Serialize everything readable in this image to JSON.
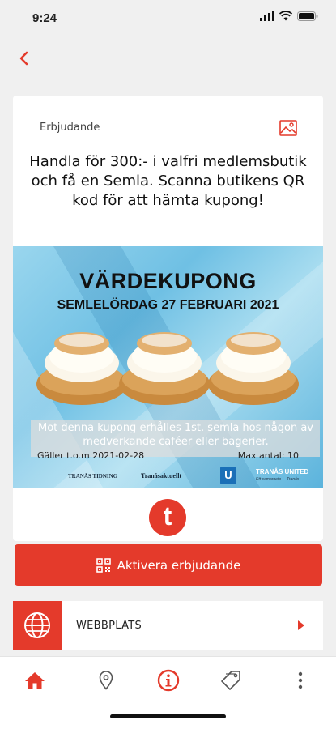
{
  "status_bar": {
    "time": "9:24"
  },
  "offer": {
    "label": "Erbjudande",
    "title": "Handla för 300:- i valfri medlemsbutik och få en Semla. Scanna butikens QR kod för att hämta kupong!"
  },
  "coupon": {
    "heading": "VÄRDEKUPONG",
    "subheading": "SEMLELÖRDAG 27 FEBRUARI 2021",
    "text": "Mot denna kupong erhålles 1st. semla hos någon av medverkande caféer eller bagerier.",
    "valid": "Gäller t.o.m 2021-02-28",
    "max": "Max antal: 10",
    "sponsors": [
      "TRANÅS TIDNING",
      "Tranåsaktuellt",
      "TRANÅS UNITED"
    ],
    "sponsor3_badge": "U",
    "sponsor3_sub": "Ett samarbete ... Tranås ..."
  },
  "brand_logo_letter": "t",
  "activate_button": {
    "label": "Aktivera erbjudande"
  },
  "website_row": {
    "label": "WEBBPLATS"
  },
  "tabs": [
    {
      "icon": "home-icon",
      "active": true
    },
    {
      "icon": "location-pin-icon",
      "active": false
    },
    {
      "icon": "info-icon",
      "active": true
    },
    {
      "icon": "tag-icon",
      "active": false
    },
    {
      "icon": "more-vertical-icon",
      "active": false
    }
  ],
  "colors": {
    "accent": "#e43a2b",
    "background": "#f0f0f0",
    "coupon_blue": "#6fc0e4"
  }
}
